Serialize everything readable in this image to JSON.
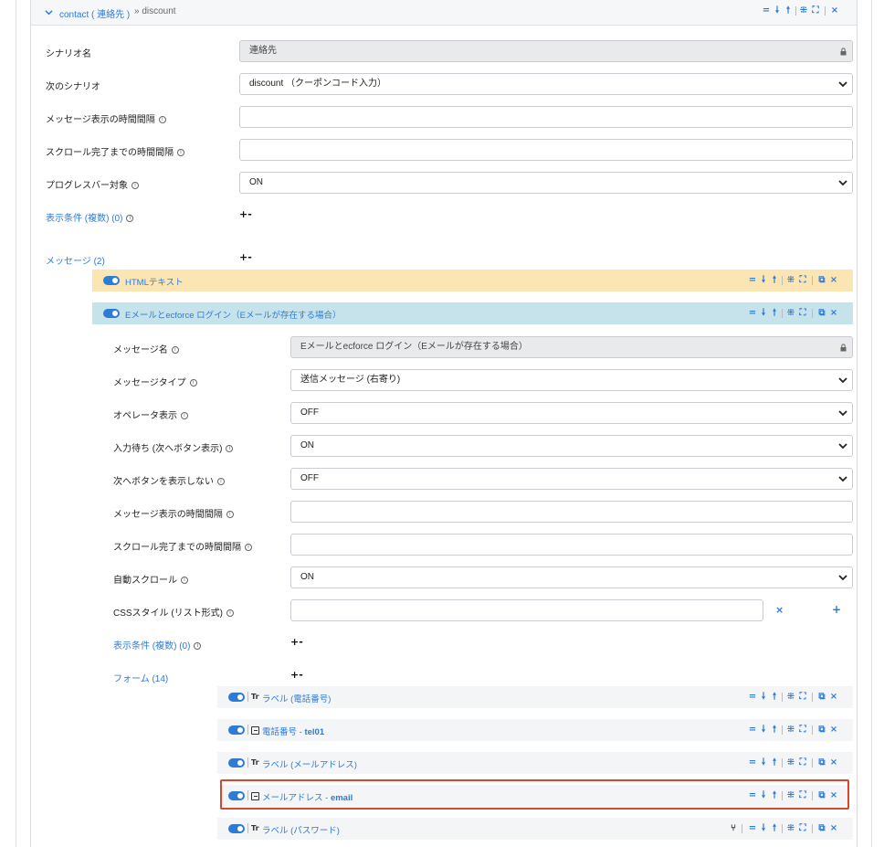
{
  "header": {
    "title": "contact ( 連絡先 )",
    "crumb": "» discount"
  },
  "scenario": {
    "name_label": "シナリオ名",
    "name_value": "連絡先",
    "next_label": "次のシナリオ",
    "next_value": "discount （クーポンコード入力）",
    "msg_interval_label": "メッセージ表示の時間間隔",
    "scroll_interval_label": "スクロール完了までの時間間隔",
    "progress_label": "プログレスバー対象",
    "progress_value": "ON",
    "conditions_label": "表示条件 (複数) (0)",
    "messages_label": "メッセージ (2)"
  },
  "messages": [
    {
      "label": "HTMLテキスト"
    },
    {
      "label": "Eメールとecforce ログイン（Eメールが存在する場合）"
    }
  ],
  "message_detail": {
    "name_label": "メッセージ名",
    "name_value": "Eメールとecforce ログイン（Eメールが存在する場合）",
    "type_label": "メッセージタイプ",
    "type_value": "送信メッセージ (右寄り)",
    "operator_label": "オペレータ表示",
    "operator_value": "OFF",
    "wait_label": "入力待ち (次へボタン表示)",
    "wait_value": "ON",
    "hide_next_label": "次へボタンを表示しない",
    "hide_next_value": "OFF",
    "msg_interval_label": "メッセージ表示の時間間隔",
    "scroll_interval_label": "スクロール完了までの時間間隔",
    "autoscroll_label": "自動スクロール",
    "autoscroll_value": "ON",
    "css_label": "CSSスタイル (リスト形式)",
    "conditions_label": "表示条件 (複数) (0)",
    "forms_label": "フォーム (14)"
  },
  "forms": [
    {
      "type": "Tr",
      "label": "ラベル (電話番号)",
      "bold": ""
    },
    {
      "type": "box",
      "label": "電話番号 - ",
      "bold": "tel01"
    },
    {
      "type": "Tr",
      "label": "ラベル (メールアドレス)",
      "bold": ""
    },
    {
      "type": "box",
      "label": "メールアドレス - ",
      "bold": "email"
    },
    {
      "type": "Tr",
      "label": "ラベル (パスワード)",
      "bold": ""
    }
  ],
  "symbols": {
    "plusminus": "+-",
    "close": "×",
    "plus": "+"
  },
  "colors": {
    "accent": "#2e7bd6",
    "yellow_bar": "#fbe5b2",
    "blue_bar": "#c6e3eb",
    "highlight": "#d9472b"
  }
}
